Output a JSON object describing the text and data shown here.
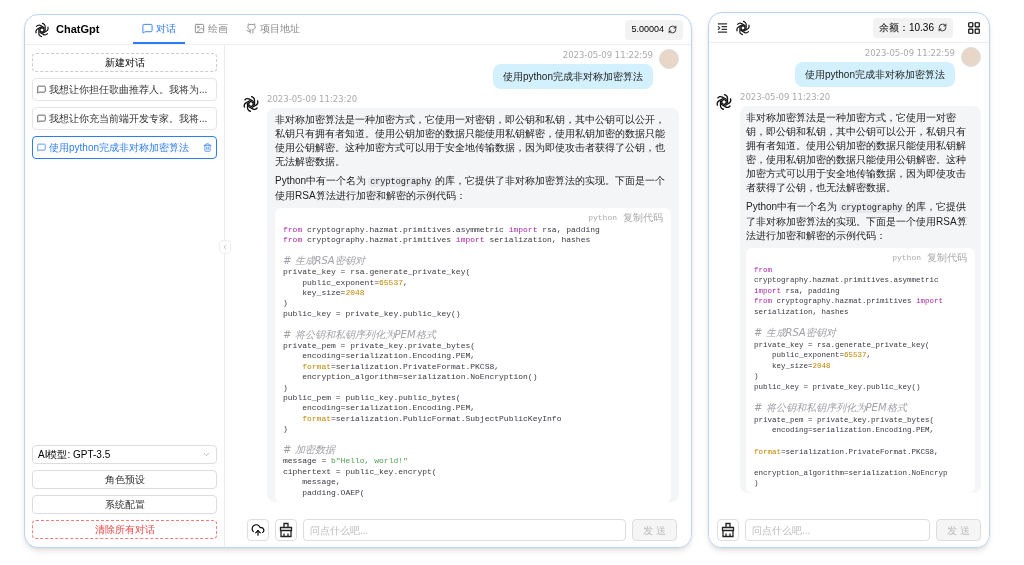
{
  "desktop": {
    "brand": "ChatGpt",
    "tabs": [
      {
        "label": "对话",
        "selected": true
      },
      {
        "label": "绘画",
        "selected": false
      },
      {
        "label": "项目地址",
        "selected": false
      }
    ],
    "balance": "5.00004",
    "sidebar": {
      "new_chat": "新建对话",
      "conversations": [
        {
          "title": "我想让你担任歌曲推荐人。我将为...",
          "selected": false
        },
        {
          "title": "我想让你充当前端开发专家。我将...",
          "selected": false
        },
        {
          "title": "使用python完成非对称加密算法",
          "selected": true
        }
      ],
      "model_select": "AI模型: GPT-3.5",
      "buttons": [
        {
          "label": "角色预设",
          "kind": "normal"
        },
        {
          "label": "系统配置",
          "kind": "normal"
        },
        {
          "label": "清除所有对话",
          "kind": "danger"
        }
      ]
    },
    "messages": [
      {
        "kind": "user",
        "time": "2023-05-09 11:22:59",
        "text": "使用python完成非对称加密算法"
      },
      {
        "kind": "assistant",
        "time": "2023-05-09 11:23:20",
        "paragraphs": [
          [
            {
              "kind": "text",
              "text": "非对称加密算法是一种加密方式，它使用一对密钥，即公钥和私钥，其中公钥可以公开，私钥只有拥有者知道。使用公钥加密的数据只能使用私钥解密，使用私钥加密的数据只能使用公钥解密。这种加密方式可以用于安全地传输数据，因为即使攻击者获得了公钥，也无法解密数据。"
            }
          ],
          [
            {
              "kind": "text",
              "text": "Python中有一个名为"
            },
            {
              "kind": "code",
              "text": "cryptography"
            },
            {
              "kind": "text",
              "text": "的库，它提供了非对称加密算法的实现。下面是一个使用RSA算法进行加密和解密的示例代码："
            }
          ]
        ],
        "code": {
          "language": "python",
          "copy": "复制代码",
          "lines": [
            {
              "kind": "code",
              "segments": [
                {
                  "kind": "keyword",
                  "text": "from"
                },
                {
                  "kind": "plain",
                  "text": " cryptography.hazmat.primitives.asymmetric "
                },
                {
                  "kind": "keyword",
                  "text": "import"
                },
                {
                  "kind": "plain",
                  "text": " rsa, padding"
                }
              ]
            },
            {
              "kind": "code",
              "segments": [
                {
                  "kind": "keyword",
                  "text": "from"
                },
                {
                  "kind": "plain",
                  "text": " cryptography.hazmat.primitives "
                },
                {
                  "kind": "keyword",
                  "text": "import"
                },
                {
                  "kind": "plain",
                  "text": " serialization, hashes"
                }
              ]
            },
            {
              "kind": "blank"
            },
            {
              "kind": "code",
              "segments": [
                {
                  "kind": "comment",
                  "text": "# 生成RSA密钥对"
                }
              ]
            },
            {
              "kind": "code",
              "segments": [
                {
                  "kind": "plain",
                  "text": "private_key = rsa.generate_private_key("
                }
              ]
            },
            {
              "kind": "code",
              "segments": [
                {
                  "kind": "plain",
                  "text": "    public_exponent="
                },
                {
                  "kind": "number",
                  "text": "65537"
                },
                {
                  "kind": "plain",
                  "text": ","
                }
              ]
            },
            {
              "kind": "code",
              "segments": [
                {
                  "kind": "plain",
                  "text": "    key_size="
                },
                {
                  "kind": "number",
                  "text": "2048"
                }
              ]
            },
            {
              "kind": "code",
              "segments": [
                {
                  "kind": "plain",
                  "text": ")"
                }
              ]
            },
            {
              "kind": "code",
              "segments": [
                {
                  "kind": "plain",
                  "text": "public_key = private_key.public_key()"
                }
              ]
            },
            {
              "kind": "blank"
            },
            {
              "kind": "code",
              "segments": [
                {
                  "kind": "comment",
                  "text": "# 将公钥和私钥序列化为PEM格式"
                }
              ]
            },
            {
              "kind": "code",
              "segments": [
                {
                  "kind": "plain",
                  "text": "private_pem = private_key.private_bytes("
                }
              ]
            },
            {
              "kind": "code",
              "segments": [
                {
                  "kind": "plain",
                  "text": "    encoding=serialization.Encoding.PEM,"
                }
              ]
            },
            {
              "kind": "code",
              "segments": [
                {
                  "kind": "param",
                  "text": "    format"
                },
                {
                  "kind": "plain",
                  "text": "=serialization.PrivateFormat.PKCS8,"
                }
              ]
            },
            {
              "kind": "code",
              "segments": [
                {
                  "kind": "plain",
                  "text": "    encryption_algorithm=serialization.NoEncryption()"
                }
              ]
            },
            {
              "kind": "code",
              "segments": [
                {
                  "kind": "plain",
                  "text": ")"
                }
              ]
            },
            {
              "kind": "code",
              "segments": [
                {
                  "kind": "plain",
                  "text": "public_pem = public_key.public_bytes("
                }
              ]
            },
            {
              "kind": "code",
              "segments": [
                {
                  "kind": "plain",
                  "text": "    encoding=serialization.Encoding.PEM,"
                }
              ]
            },
            {
              "kind": "code",
              "segments": [
                {
                  "kind": "param",
                  "text": "    format"
                },
                {
                  "kind": "plain",
                  "text": "=serialization.PublicFormat.SubjectPublicKeyInfo"
                }
              ]
            },
            {
              "kind": "code",
              "segments": [
                {
                  "kind": "plain",
                  "text": ")"
                }
              ]
            },
            {
              "kind": "blank"
            },
            {
              "kind": "code",
              "segments": [
                {
                  "kind": "comment",
                  "text": "# 加密数据"
                }
              ]
            },
            {
              "kind": "code",
              "segments": [
                {
                  "kind": "plain",
                  "text": "message = "
                },
                {
                  "kind": "string",
                  "text": "b\"Hello, world!\""
                }
              ]
            },
            {
              "kind": "code",
              "segments": [
                {
                  "kind": "plain",
                  "text": "ciphertext = public_key.encrypt("
                }
              ]
            },
            {
              "kind": "code",
              "segments": [
                {
                  "kind": "plain",
                  "text": "    message,"
                }
              ]
            },
            {
              "kind": "code",
              "segments": [
                {
                  "kind": "plain",
                  "text": "    padding.OAEP("
                }
              ]
            }
          ]
        }
      }
    ],
    "input": {
      "placeholder": "问点什么吧...",
      "send": "发 送"
    }
  },
  "mobile": {
    "balance": "余额：10.36",
    "messages": [
      {
        "kind": "user",
        "time": "2023-05-09 11:22:59",
        "text": "使用python完成非对称加密算法"
      },
      {
        "kind": "assistant",
        "time": "2023-05-09 11:23:20",
        "paragraphs": [
          [
            {
              "kind": "text",
              "text": "非对称加密算法是一种加密方式，它使用一对密钥，即公钥和私钥，其中公钥可以公开，私钥只有拥有者知道。使用公钥加密的数据只能使用私钥解密，使用私钥加密的数据只能使用公钥解密。这种加密方式可以用于安全地传输数据，因为即使攻击者获得了公钥，也无法解密数据。"
            }
          ],
          [
            {
              "kind": "text",
              "text": "Python中有一个名为"
            },
            {
              "kind": "code",
              "text": "cryptography"
            },
            {
              "kind": "text",
              "text": "的库，它提供了非对称加密算法的实现。下面是一个使用RSA算法进行加密和解密的示例代码："
            }
          ]
        ],
        "code": {
          "language": "python",
          "copy": "复制代码",
          "lines": [
            {
              "kind": "code",
              "segments": [
                {
                  "kind": "keyword",
                  "text": "from"
                }
              ]
            },
            {
              "kind": "code",
              "segments": [
                {
                  "kind": "plain",
                  "text": "cryptography.hazmat.primitives.asymmetric"
                }
              ]
            },
            {
              "kind": "code",
              "segments": [
                {
                  "kind": "keyword",
                  "text": "import"
                },
                {
                  "kind": "plain",
                  "text": " rsa, padding"
                }
              ]
            },
            {
              "kind": "code",
              "segments": [
                {
                  "kind": "keyword",
                  "text": "from"
                },
                {
                  "kind": "plain",
                  "text": " cryptography.hazmat.primitives "
                },
                {
                  "kind": "keyword",
                  "text": "import"
                }
              ]
            },
            {
              "kind": "code",
              "segments": [
                {
                  "kind": "plain",
                  "text": "serialization, hashes"
                }
              ]
            },
            {
              "kind": "blank"
            },
            {
              "kind": "code",
              "segments": [
                {
                  "kind": "comment",
                  "text": "# 生成RSA密钥对"
                }
              ]
            },
            {
              "kind": "code",
              "segments": [
                {
                  "kind": "plain",
                  "text": "private_key = rsa.generate_private_key("
                }
              ]
            },
            {
              "kind": "code",
              "segments": [
                {
                  "kind": "plain",
                  "text": "    public_exponent="
                },
                {
                  "kind": "number",
                  "text": "65537"
                },
                {
                  "kind": "plain",
                  "text": ","
                }
              ]
            },
            {
              "kind": "code",
              "segments": [
                {
                  "kind": "plain",
                  "text": "    key_size="
                },
                {
                  "kind": "number",
                  "text": "2048"
                }
              ]
            },
            {
              "kind": "code",
              "segments": [
                {
                  "kind": "plain",
                  "text": ")"
                }
              ]
            },
            {
              "kind": "code",
              "segments": [
                {
                  "kind": "plain",
                  "text": "public_key = private_key.public_key()"
                }
              ]
            },
            {
              "kind": "blank"
            },
            {
              "kind": "code",
              "segments": [
                {
                  "kind": "comment",
                  "text": "# 将公钥和私钥序列化为PEM格式"
                }
              ]
            },
            {
              "kind": "code",
              "segments": [
                {
                  "kind": "plain",
                  "text": "private_pem = private_key.private_bytes("
                }
              ]
            },
            {
              "kind": "code",
              "segments": [
                {
                  "kind": "plain",
                  "text": "    encoding=serialization.Encoding.PEM,"
                }
              ]
            },
            {
              "kind": "blank"
            },
            {
              "kind": "code",
              "segments": [
                {
                  "kind": "param",
                  "text": "format"
                },
                {
                  "kind": "plain",
                  "text": "=serialization.PrivateFormat.PKCS8,"
                }
              ]
            },
            {
              "kind": "blank"
            },
            {
              "kind": "code",
              "segments": [
                {
                  "kind": "plain",
                  "text": "encryption_algorithm=serialization.NoEncryp"
                }
              ]
            },
            {
              "kind": "code",
              "segments": [
                {
                  "kind": "plain",
                  "text": ")"
                }
              ]
            }
          ]
        }
      }
    ],
    "input": {
      "placeholder": "问点什么吧...",
      "send": "发 送"
    }
  }
}
